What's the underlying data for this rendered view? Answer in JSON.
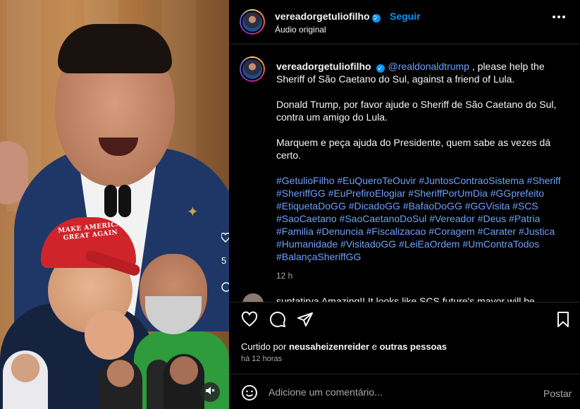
{
  "post": {
    "username": "vereadorgetuliofilho",
    "verified_icon": "verified-badge-icon",
    "follow_label": "Seguir",
    "separator": "•",
    "audio_label": "Áudio original",
    "more_icon": "more-options-icon"
  },
  "media": {
    "cap_text": "MAKE AMERICA GREAT AGAIN",
    "mute_icon": "muted-speaker-icon"
  },
  "caption": {
    "username": "vereadorgetuliofilho",
    "mention": "@realdonaldtrump",
    "line1_rest": ", please help the Sheriff of São Caetano do Sul, against a friend of Lula.",
    "para2": "Donald Trump, por favor ajude o Sheriff de São Caetano do Sul, contra um amigo do Lula.",
    "para3": "Marquem e peça ajuda do Presidente, quem sabe as vezes dá certo.",
    "hashtags": [
      "#GetulioFilho",
      "#EuQueroTeOuvir",
      "#JuntosContraoSistema",
      "#Sheriff",
      "#SheriffGG",
      "#EuPrefiroElogiar",
      "#SheriffPorUmDia",
      "#GGprefeito",
      "#EtiquetaDoGG",
      "#DicadoGG",
      "#BafaoDoGG",
      "#GGVisita",
      "#SCS",
      "#SaoCaetano",
      "#SaoCaetanoDoSul",
      "#Vereador",
      "#Deus",
      "#Patria",
      "#Familia",
      "#Denuncia",
      "#Fiscalizacao",
      "#Coragem",
      "#Carater",
      "#Justica",
      "#Humanidade",
      "#VisitadoGG",
      "#LeiEaOrdem",
      "#UmContraTodos",
      "#BalançaSheriffGG"
    ],
    "time": "12 h"
  },
  "comment_peek": {
    "text": "suntatirya Amazing!! It looks like SCS future's mayor will be"
  },
  "actions": {
    "like_icon": "heart-icon",
    "comment_icon": "comment-bubble-icon",
    "share_icon": "paper-plane-icon",
    "save_icon": "bookmark-icon"
  },
  "likes": {
    "prefix": "Curtido por",
    "user": "neusaheizenreider",
    "conj": "e",
    "others": "outras pessoas"
  },
  "ago": "há 12 horas",
  "add_comment": {
    "emoji_icon": "emoji-smiley-icon",
    "placeholder": "Adicione um comentário...",
    "post_label": "Postar"
  }
}
